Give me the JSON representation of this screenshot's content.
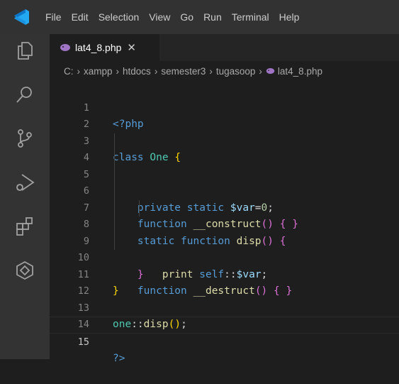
{
  "menu": [
    "File",
    "Edit",
    "Selection",
    "View",
    "Go",
    "Run",
    "Terminal",
    "Help"
  ],
  "tab": {
    "label": "lat4_8.php",
    "close": "✕"
  },
  "breadcrumb": [
    "C:",
    "xampp",
    "htdocs",
    "semester3",
    "tugasoop",
    "lat4_8.php"
  ],
  "line_numbers": [
    "1",
    "2",
    "3",
    "4",
    "5",
    "6",
    "7",
    "8",
    "9",
    "10",
    "11",
    "12",
    "13",
    "14",
    "15"
  ],
  "code": {
    "l1": "<?php",
    "l3_kw": "class",
    "l3_name": "One",
    "l3_brace": "{",
    "l5_kw": "private static",
    "l5_var": "$var",
    "l5_eq": "=",
    "l5_num": "0",
    "l5_semi": ";",
    "l6_kw": "function",
    "l6_fn": "__construct",
    "l6_paren": "()",
    "l6_braces": "{ }",
    "l7_kw": "static function",
    "l7_fn": "disp",
    "l7_paren": "()",
    "l7_brace": "{",
    "l8_print": "print",
    "l8_self": "self",
    "l8_sep": "::",
    "l8_var": "$var",
    "l8_semi": ";",
    "l9_brace": "}",
    "l10_kw": "function",
    "l10_fn": "__destruct",
    "l10_paren": "()",
    "l10_braces": "{ }",
    "l11_brace": "}",
    "l13_cls": "one",
    "l13_sep": "::",
    "l13_fn": "disp",
    "l13_paren": "()",
    "l13_semi": ";",
    "l15": "?>"
  },
  "colors": {
    "accent": "#007acc",
    "php_icon": "#a074c4"
  }
}
